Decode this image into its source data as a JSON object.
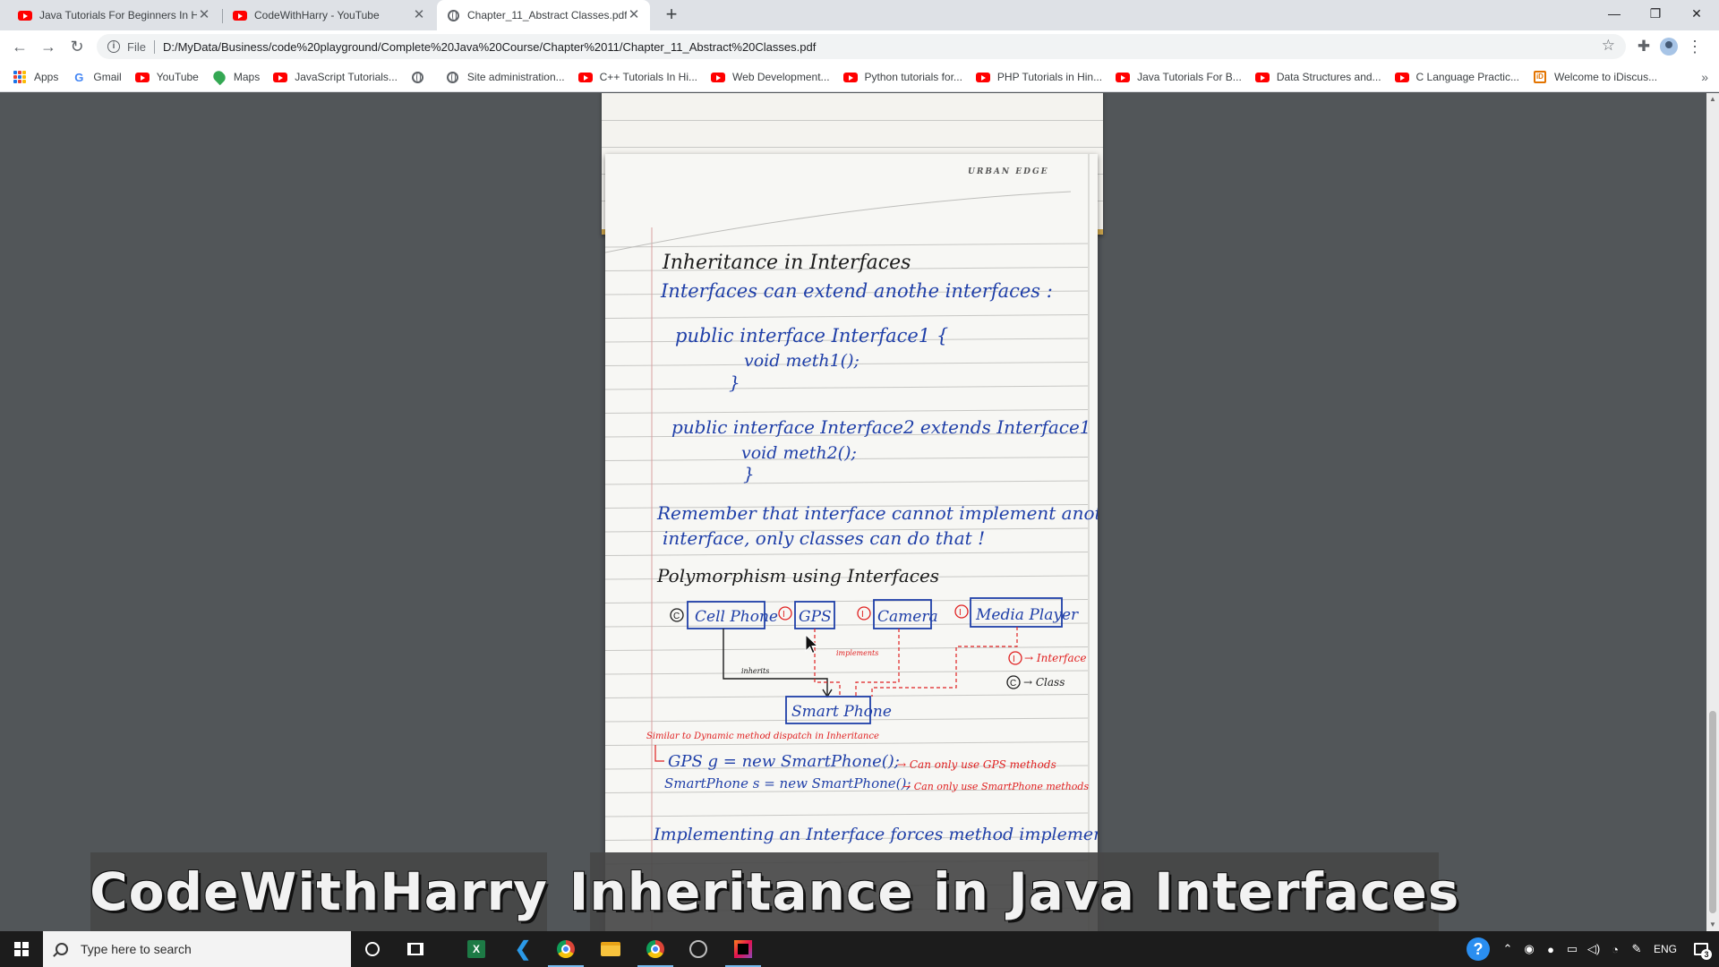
{
  "browser": {
    "tabs": [
      {
        "title": "Java Tutorials For Beginners In Hi",
        "favicon": "youtube-icon"
      },
      {
        "title": "CodeWithHarry - YouTube",
        "favicon": "youtube-icon"
      },
      {
        "title": "Chapter_11_Abstract Classes.pdf",
        "favicon": "globe-icon",
        "active": true
      }
    ],
    "new_tab_label": "+",
    "address": {
      "scheme": "File",
      "url": "D:/MyData/Business/code%20playground/Complete%20Java%20Course/Chapter%2011/Chapter_11_Abstract%20Classes.pdf"
    },
    "bookmarks": [
      {
        "label": "Apps",
        "icon": "apps-grid-icon"
      },
      {
        "label": "Gmail",
        "icon": "google-icon"
      },
      {
        "label": "YouTube",
        "icon": "youtube-icon"
      },
      {
        "label": "Maps",
        "icon": "maps-icon"
      },
      {
        "label": "JavaScript Tutorials...",
        "icon": "youtube-icon"
      },
      {
        "label": "",
        "icon": "globe-icon"
      },
      {
        "label": "Site administration...",
        "icon": "globe-icon"
      },
      {
        "label": "C++ Tutorials In Hi...",
        "icon": "youtube-icon"
      },
      {
        "label": "Web Development...",
        "icon": "youtube-icon"
      },
      {
        "label": "Python tutorials for...",
        "icon": "youtube-icon"
      },
      {
        "label": "PHP Tutorials in Hin...",
        "icon": "youtube-icon"
      },
      {
        "label": "Java Tutorials For B...",
        "icon": "youtube-icon"
      },
      {
        "label": "Data Structures and...",
        "icon": "youtube-icon"
      },
      {
        "label": "C Language Practic...",
        "icon": "youtube-icon"
      },
      {
        "label": "Welcome to iDiscus...",
        "icon": "idiscuss-icon"
      }
    ],
    "bookmarks_overflow": "»"
  },
  "notes_page": {
    "brand": "URBAN EDGE",
    "heading": "Inheritance in Interfaces",
    "subheading": "Interfaces can extend anothe interfaces :",
    "code1": [
      "public interface Interface1 {",
      "void meth1();",
      "}"
    ],
    "code2": [
      "public interface Interface2 extends Interface1 {",
      "void meth2();",
      "}"
    ],
    "remember": [
      "Remember that interface cannot implement another",
      "interface, only classes can do that !"
    ],
    "poly_heading": "Polymorphism using Interfaces",
    "diagram": {
      "class_marker": "C",
      "interface_marker": "I",
      "boxes": [
        "Cell Phone",
        "GPS",
        "Camera",
        "Media Player",
        "Smart Phone"
      ],
      "inherits_label": "inherits",
      "implements_label": "implements",
      "legend": [
        "→ Interface",
        "→ Class"
      ]
    },
    "dispatch_note": "Similar to Dynamic method dispatch in Inheritance",
    "code3": [
      "GPS g = new SmartPhone();",
      "SmartPhone s = new SmartPhone();"
    ],
    "code3_notes": [
      "→ Can only use GPS methods",
      "→ Can only use SmartPhone methods"
    ],
    "final_line": "Implementing an Interface forces method implementation."
  },
  "overlay": {
    "channel": "CodeWithHarry",
    "video_title": "Inheritance in Java Interfaces"
  },
  "taskbar": {
    "search_placeholder": "Type here to search",
    "apps": [
      "cortana-icon",
      "task-view-icon",
      "excel-icon",
      "vscode-icon",
      "chrome-icon",
      "file-explorer-icon",
      "chrome-icon",
      "obs-icon",
      "jetbrains-icon"
    ],
    "language": "ENG",
    "notification_count": "3"
  },
  "colors": {
    "ink_blue": "#1f3fa8",
    "ink_black": "#1b1b1b",
    "ink_red": "#e02020",
    "viewer_bg": "#525659"
  }
}
